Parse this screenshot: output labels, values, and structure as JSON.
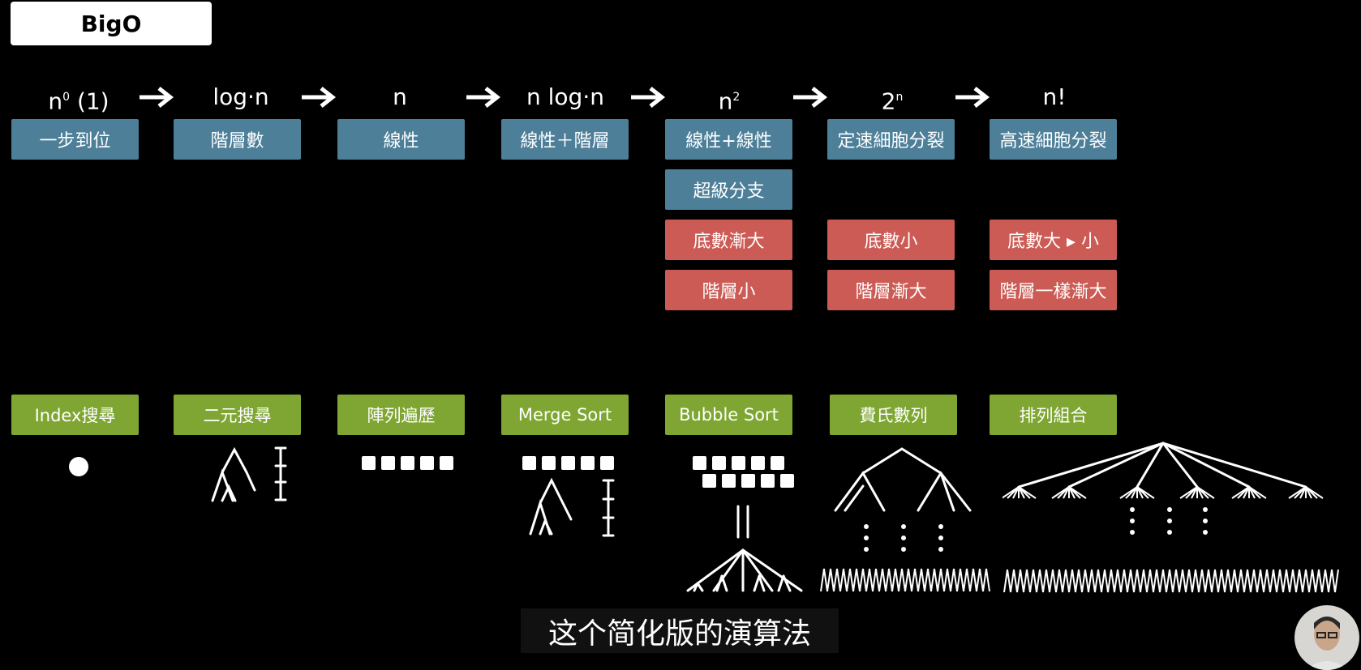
{
  "title": "BigO",
  "complexities": [
    {
      "base": "n",
      "sup": "0",
      "tail": " (1)"
    },
    {
      "base": "log·n",
      "sup": "",
      "tail": ""
    },
    {
      "base": "n",
      "sup": "",
      "tail": ""
    },
    {
      "base": "n log·n",
      "sup": "",
      "tail": ""
    },
    {
      "base": "n",
      "sup": "2",
      "tail": ""
    },
    {
      "base": "2",
      "sup": "n",
      "tail": ""
    },
    {
      "base": "n!",
      "sup": "",
      "tail": ""
    }
  ],
  "descriptions": [
    "一步到位",
    "階層數",
    "線性",
    "線性＋階層",
    "線性+線性",
    "定速細胞分裂",
    "高速細胞分裂"
  ],
  "extra_blue": "超級分支",
  "red_rows": {
    "base_row": [
      "底數漸大",
      "底數小",
      "底數大 ▸ 小"
    ],
    "level_row": [
      "階層小",
      "階層漸大",
      "階層一樣漸大"
    ]
  },
  "examples": [
    "Index搜尋",
    "二元搜尋",
    "陣列遍歷",
    "Merge Sort",
    "Bubble Sort",
    "費氏數列",
    "排列組合"
  ],
  "subtitle": "这个简化版的演算法",
  "colors": {
    "blue": "#4d7f99",
    "red": "#cc5b55",
    "green": "#7fa632"
  }
}
